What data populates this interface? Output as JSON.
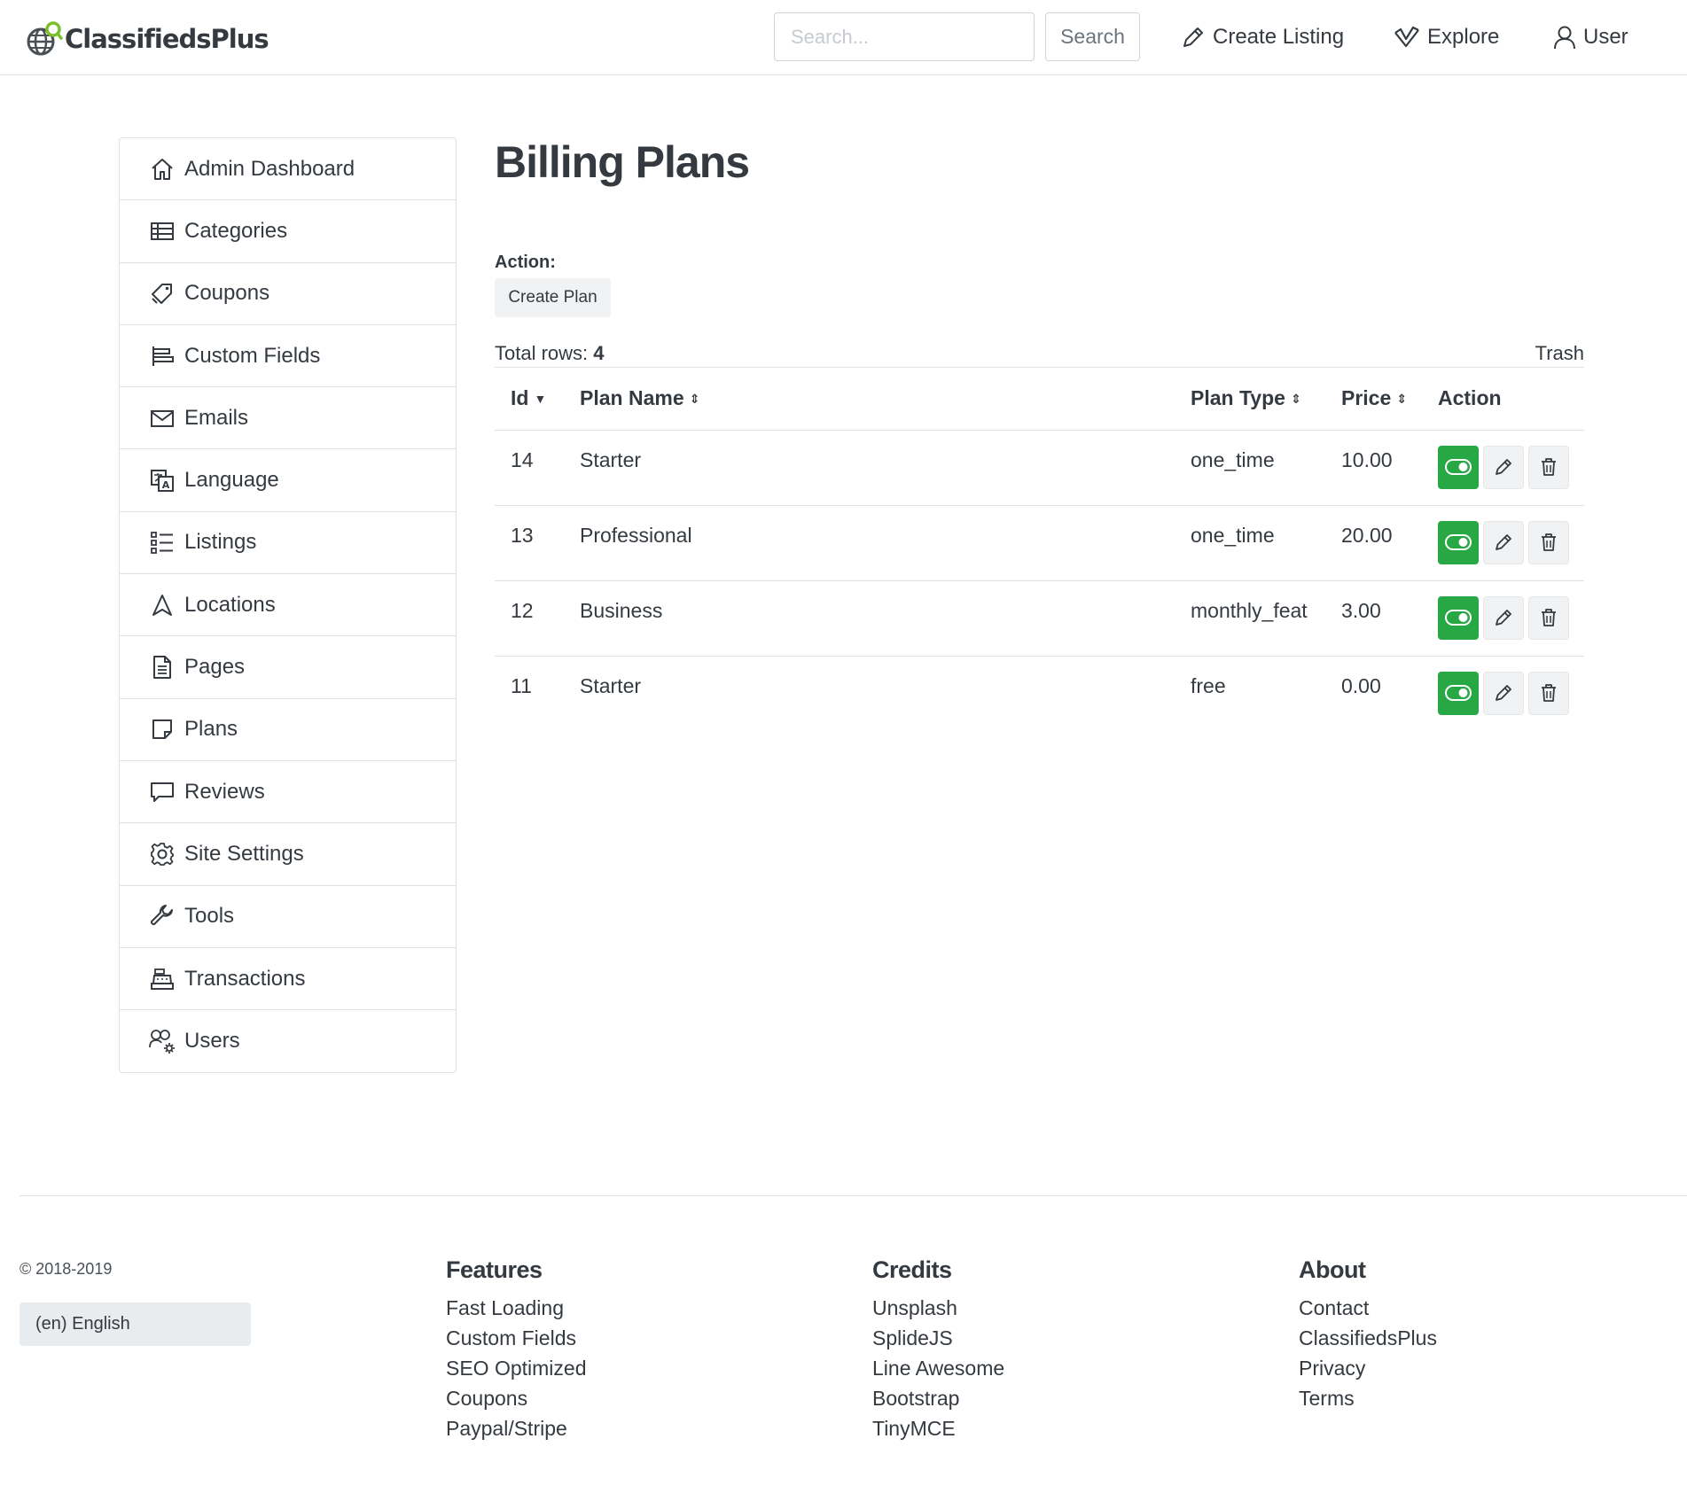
{
  "header": {
    "brand": "ClassifiedsPlus",
    "search_placeholder": "Search...",
    "search_button": "Search",
    "nav": {
      "create_listing": "Create Listing",
      "explore": "Explore",
      "user": "User"
    }
  },
  "sidebar": {
    "items": [
      {
        "label": "Admin Dashboard",
        "icon": "home-icon"
      },
      {
        "label": "Categories",
        "icon": "table-icon"
      },
      {
        "label": "Coupons",
        "icon": "tags-icon"
      },
      {
        "label": "Custom Fields",
        "icon": "fields-icon"
      },
      {
        "label": "Emails",
        "icon": "envelope-icon"
      },
      {
        "label": "Language",
        "icon": "language-icon"
      },
      {
        "label": "Listings",
        "icon": "list-icon"
      },
      {
        "label": "Locations",
        "icon": "location-icon"
      },
      {
        "label": "Pages",
        "icon": "file-icon"
      },
      {
        "label": "Plans",
        "icon": "sticky-note-icon"
      },
      {
        "label": "Reviews",
        "icon": "comment-icon"
      },
      {
        "label": "Site Settings",
        "icon": "gear-icon"
      },
      {
        "label": "Tools",
        "icon": "wrench-icon"
      },
      {
        "label": "Transactions",
        "icon": "cash-register-icon"
      },
      {
        "label": "Users",
        "icon": "users-cog-icon"
      }
    ]
  },
  "main": {
    "title": "Billing Plans",
    "action_label": "Action:",
    "create_plan": "Create Plan",
    "total_rows_label": "Total rows:",
    "total_rows_value": "4",
    "trash": "Trash",
    "table": {
      "columns": [
        "Id",
        "Plan Name",
        "Plan Type",
        "Price",
        "Action"
      ],
      "rows": [
        {
          "id": "14",
          "name": "Starter",
          "type": "one_time",
          "price": "10.00"
        },
        {
          "id": "13",
          "name": "Professional",
          "type": "one_time",
          "price": "20.00"
        },
        {
          "id": "12",
          "name": "Business",
          "type": "monthly_feat",
          "price": "3.00"
        },
        {
          "id": "11",
          "name": "Starter",
          "type": "free",
          "price": "0.00"
        }
      ]
    }
  },
  "footer": {
    "copyright": "© 2018-2019",
    "language": "(en) English",
    "columns": [
      {
        "heading": "Features",
        "links": [
          "Fast Loading",
          "Custom Fields",
          "SEO Optimized",
          "Coupons",
          "Paypal/Stripe"
        ]
      },
      {
        "heading": "Credits",
        "links": [
          "Unsplash",
          "SplideJS",
          "Line Awesome",
          "Bootstrap",
          "TinyMCE"
        ]
      },
      {
        "heading": "About",
        "links": [
          "Contact",
          "ClassifiedsPlus",
          "Privacy",
          "Terms"
        ]
      }
    ]
  },
  "colors": {
    "accent_green": "#28a745",
    "logo_green": "#7cbf2e",
    "text": "#343a40",
    "border": "#dee2e6"
  }
}
